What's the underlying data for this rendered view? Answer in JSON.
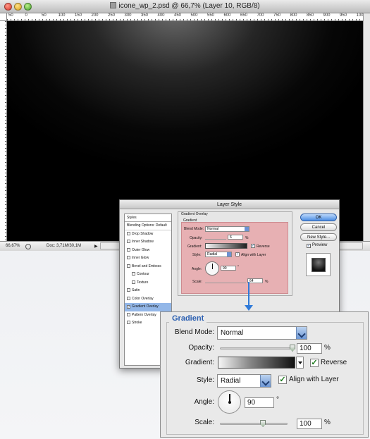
{
  "document": {
    "title": "icone_wp_2.psd @ 66,7% (Layer 10, RGB/8)",
    "ruler_marks": [
      "50",
      "0",
      "50",
      "100",
      "150",
      "200",
      "250",
      "300",
      "350",
      "400",
      "450",
      "500",
      "550",
      "600",
      "650",
      "700",
      "750",
      "800",
      "850",
      "900",
      "950",
      "100"
    ],
    "status": {
      "zoom": "66,67%",
      "doc_info": "Doc: 3,71M/30,1M",
      "arrow": "▶"
    }
  },
  "layer_style": {
    "title": "Layer Style",
    "styles_header": "Styles",
    "blending_options": "Blending Options: Default",
    "styles": [
      {
        "label": "Drop Shadow",
        "checked": false,
        "sub": false
      },
      {
        "label": "Inner Shadow",
        "checked": false,
        "sub": false
      },
      {
        "label": "Outer Glow",
        "checked": false,
        "sub": false
      },
      {
        "label": "Inner Glow",
        "checked": false,
        "sub": false
      },
      {
        "label": "Bevel and Emboss",
        "checked": false,
        "sub": false
      },
      {
        "label": "Contour",
        "checked": false,
        "sub": true
      },
      {
        "label": "Texture",
        "checked": false,
        "sub": true
      },
      {
        "label": "Satin",
        "checked": false,
        "sub": false
      },
      {
        "label": "Color Overlay",
        "checked": false,
        "sub": false
      },
      {
        "label": "Gradient Overlay",
        "checked": true,
        "sub": false
      },
      {
        "label": "Pattern Overlay",
        "checked": false,
        "sub": false
      },
      {
        "label": "Stroke",
        "checked": false,
        "sub": false
      }
    ],
    "group_title": "Gradient Overlay",
    "sub_title": "Gradient",
    "small": {
      "blend_label": "Blend Mode:",
      "blend_value": "Normal",
      "opacity_label": "Opacity:",
      "opacity_value": "6",
      "opacity_unit": "%",
      "gradient_label": "Gradient:",
      "reverse_label": "Reverse",
      "style_label": "Style:",
      "style_value": "Radial",
      "align_label": "Align with Layer",
      "angle_label": "Angle:",
      "angle_value": "90",
      "angle_unit": "°",
      "scale_label": "Scale:",
      "scale_value": "64",
      "scale_unit": "%"
    },
    "buttons": {
      "ok": "OK",
      "cancel": "Cancel",
      "new_style": "New Style..."
    },
    "preview_label": "Preview",
    "preview_checked": true
  },
  "zoom_panel": {
    "legend": "Gradient",
    "blend_label": "Blend Mode:",
    "blend_value": "Normal",
    "opacity_label": "Opacity:",
    "opacity_value": "100",
    "opacity_unit": "%",
    "opacity_fraction": 1.0,
    "gradient_label": "Gradient:",
    "reverse_label": "Reverse",
    "reverse_checked": true,
    "style_label": "Style:",
    "style_value": "Radial",
    "align_label": "Align with Layer",
    "align_checked": true,
    "angle_label": "Angle:",
    "angle_value": "90",
    "angle_unit": "°",
    "scale_label": "Scale:",
    "scale_value": "100",
    "scale_unit": "%",
    "scale_fraction": 0.64
  },
  "colors": {
    "accent": "#2f7ad9",
    "selection": "#93b7e8",
    "pink_highlight": "#e7b0b3",
    "legend": "#2b5fb1"
  }
}
